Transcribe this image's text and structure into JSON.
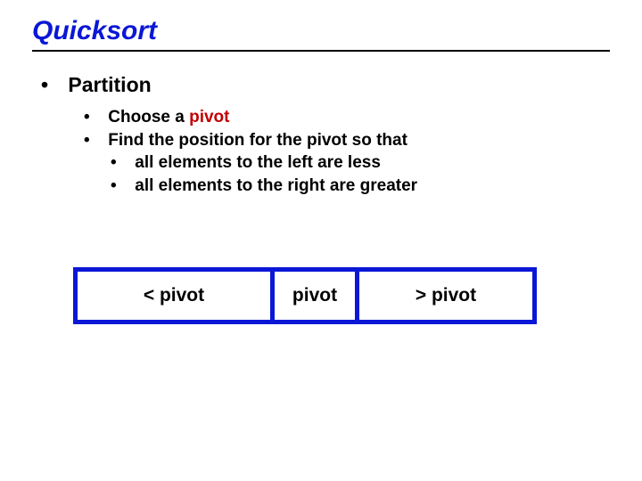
{
  "title": "Quicksort",
  "bullets": {
    "lvl1": "Partition",
    "lvl2a_prefix": "Choose a ",
    "lvl2a_pivot": "pivot",
    "lvl2b": "Find the position for the pivot so that",
    "lvl3a": "all elements to the left are less",
    "lvl3b": "all elements to the right are greater"
  },
  "diagram": {
    "left": "< pivot",
    "mid": "pivot",
    "right": "> pivot"
  }
}
